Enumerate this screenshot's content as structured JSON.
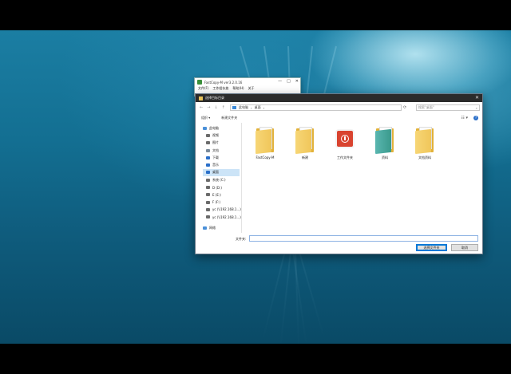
{
  "fastcopy_window": {
    "title": "FastCopy-M ver3.2.0.16",
    "controls": [
      "—",
      "□",
      "✕"
    ],
    "menu": [
      "文件(F)",
      "工作组存放",
      "帮助(H)",
      "关于"
    ]
  },
  "dialog": {
    "title": "选择目标目录",
    "close_glyph": "✕",
    "nav_buttons": [
      "←",
      "→",
      "↓",
      "↑"
    ],
    "breadcrumb": [
      "此电脑",
      "›",
      "桌面",
      "›"
    ],
    "refresh_glyph": "⟳",
    "search_placeholder": "搜索\"桌面\"",
    "search_glyph": "⌕",
    "organize_label": "组织 ▾",
    "new_folder_label": "新建文件夹",
    "view_glyph": "☷ ▾",
    "help_glyph": "?",
    "nav_items": [
      {
        "label": "此电脑",
        "icon": "computer-icon",
        "color": "#4a90d9",
        "selected": false,
        "indent": false
      },
      {
        "label": "视频",
        "icon": "video-icon",
        "color": "#6b6b6b",
        "selected": false,
        "indent": true
      },
      {
        "label": "图片",
        "icon": "pictures-icon",
        "color": "#6b6b6b",
        "selected": false,
        "indent": true
      },
      {
        "label": "文档",
        "icon": "documents-icon",
        "color": "#7a8a9a",
        "selected": false,
        "indent": true
      },
      {
        "label": "下载",
        "icon": "download-icon",
        "color": "#2a6fc9",
        "selected": false,
        "indent": true
      },
      {
        "label": "音乐",
        "icon": "music-icon",
        "color": "#2a6fc9",
        "selected": false,
        "indent": true
      },
      {
        "label": "桌面",
        "icon": "desktop-icon",
        "color": "#2a6fc9",
        "selected": true,
        "indent": true
      },
      {
        "label": "系统 (C:)",
        "icon": "drive-icon",
        "color": "#6b6b6b",
        "selected": false,
        "indent": true
      },
      {
        "label": "D (D:)",
        "icon": "drive-icon",
        "color": "#6b6b6b",
        "selected": false,
        "indent": true
      },
      {
        "label": "E (E:)",
        "icon": "drive-icon",
        "color": "#6b6b6b",
        "selected": false,
        "indent": true
      },
      {
        "label": "F (F:)",
        "icon": "drive-icon",
        "color": "#6b6b6b",
        "selected": false,
        "indent": true
      },
      {
        "label": "yc (\\\\192.168.1...)",
        "icon": "network-drive-icon",
        "color": "#6b6b6b",
        "selected": false,
        "indent": true
      },
      {
        "label": "yc (\\\\192.168.1...)",
        "icon": "network-drive-icon",
        "color": "#6b6b6b",
        "selected": false,
        "indent": true
      },
      {
        "label": "网络",
        "icon": "network-icon",
        "color": "#4a90d9",
        "selected": false,
        "indent": false
      }
    ],
    "files": [
      {
        "label": "FastCopy-M",
        "kind": "folder"
      },
      {
        "label": "新建",
        "kind": "folder"
      },
      {
        "label": "工作文件夹",
        "kind": "app"
      },
      {
        "label": "资料",
        "kind": "folder-teal"
      },
      {
        "label": "文档资料",
        "kind": "folder"
      }
    ],
    "filename_label": "文件夹:",
    "filename_value": "",
    "select_button": "选择文件夹",
    "cancel_button": "取消"
  }
}
